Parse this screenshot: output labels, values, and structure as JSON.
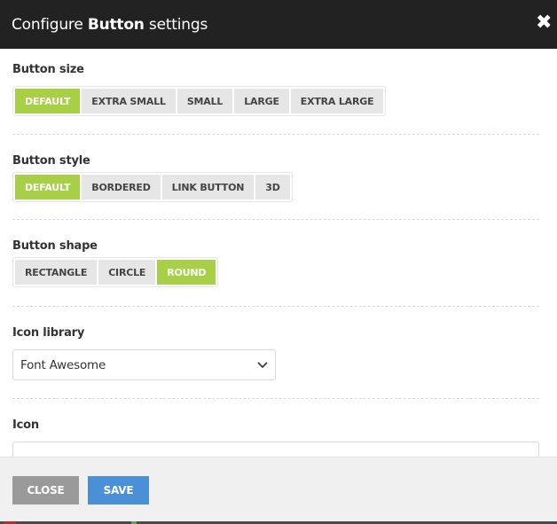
{
  "header": {
    "title_prefix": "Configure ",
    "title_bold": "Button",
    "title_suffix": " settings"
  },
  "fields": {
    "button_size": {
      "label": "Button size",
      "options": [
        "DEFAULT",
        "EXTRA SMALL",
        "SMALL",
        "LARGE",
        "EXTRA LARGE"
      ],
      "selected": "DEFAULT"
    },
    "button_style": {
      "label": "Button style",
      "options": [
        "DEFAULT",
        "BORDERED",
        "LINK BUTTON",
        "3D"
      ],
      "selected": "DEFAULT"
    },
    "button_shape": {
      "label": "Button shape",
      "options": [
        "RECTANGLE",
        "CIRCLE",
        "ROUND"
      ],
      "selected": "ROUND"
    },
    "icon_library": {
      "label": "Icon library",
      "value": "Font Awesome"
    },
    "icon": {
      "label": "Icon"
    }
  },
  "footer": {
    "close_label": "CLOSE",
    "save_label": "SAVE"
  },
  "colors": {
    "accent": "#a7d046",
    "header_bg": "#222222",
    "save_button": "#4a90d6",
    "close_button": "#9a9a9a"
  }
}
